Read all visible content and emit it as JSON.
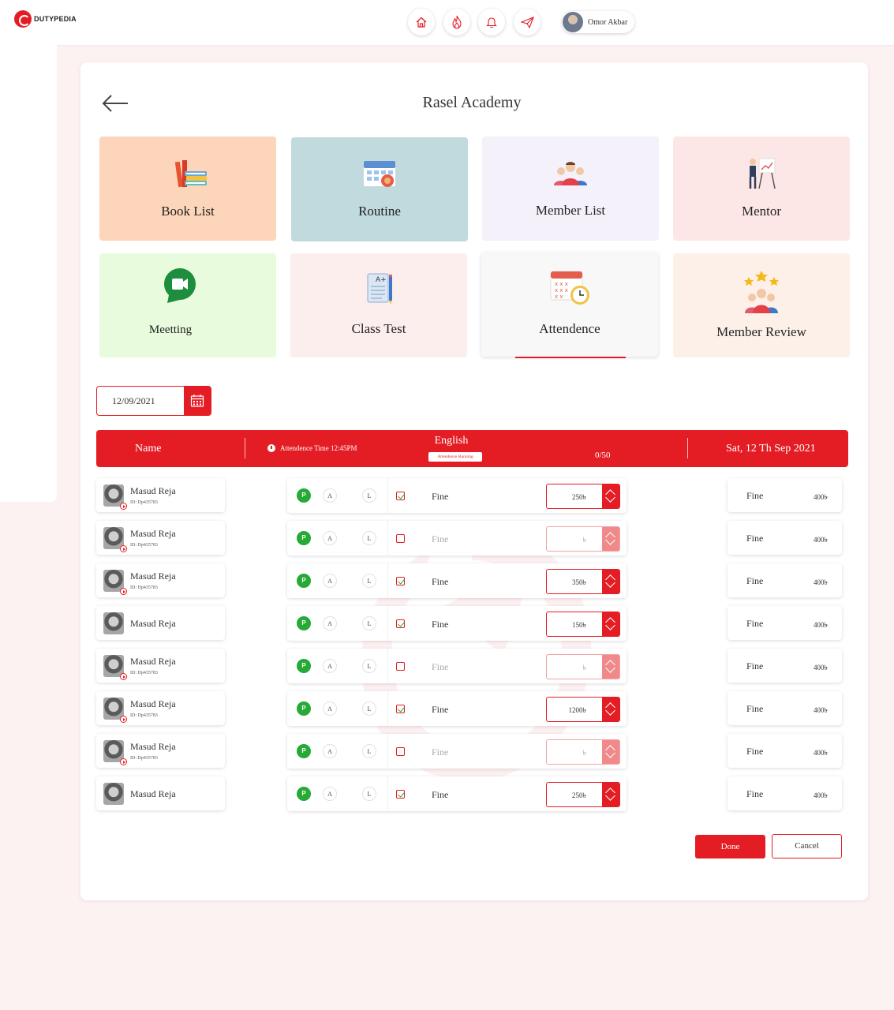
{
  "brand": {
    "name": "DUTYPEDIA",
    "accent": "#e41d25"
  },
  "nav": {
    "icons": [
      "home-icon",
      "fire-icon",
      "bell-icon",
      "send-icon"
    ],
    "user_name": "Omor Akbar"
  },
  "page": {
    "title": "Rasel Academy"
  },
  "tiles": [
    {
      "label": "Book List",
      "bg": "#fcd5ba",
      "icon": "books-icon"
    },
    {
      "label": "Routine",
      "bg": "#c1dade",
      "icon": "calendar-icon"
    },
    {
      "label": "Member List",
      "bg": "#f4f1fb",
      "icon": "members-icon"
    },
    {
      "label": "Mentor",
      "bg": "#fde6e6",
      "icon": "mentor-icon"
    },
    {
      "label": "Meetting",
      "bg": "#e8fbdc",
      "icon": "video-call-icon"
    },
    {
      "label": "Class Test",
      "bg": "#fdeeee",
      "icon": "test-paper-icon"
    },
    {
      "label": "Attendence",
      "bg": "#f8f8f8",
      "icon": "attendance-calendar-icon"
    },
    {
      "label": "Member Review",
      "bg": "#fdf0e9",
      "icon": "review-stars-icon"
    }
  ],
  "date_input": {
    "value": "12/09/2021"
  },
  "table_header": {
    "name": "Name",
    "attendance_time": "Attendence Time 12:45PM",
    "subject": "English",
    "status": "Attendence Running",
    "count": "0/50",
    "date": "Sat, 12 Th Sep 2021"
  },
  "attendance_labels": {
    "present": "P",
    "absent": "A",
    "leave": "L"
  },
  "rows": [
    {
      "name": "Masud Reja",
      "id": "ID: Dp435783",
      "fine_checked": true,
      "fine_label": "Fine",
      "amount": "250৳",
      "right_label": "Fine",
      "right_amount": "400৳"
    },
    {
      "name": "Masud Reja",
      "id": "ID: Dp435783",
      "fine_checked": false,
      "fine_label": "Fine",
      "amount": "৳",
      "right_label": "Fine",
      "right_amount": "400৳"
    },
    {
      "name": "Masud Reja",
      "id": "ID: Dp435783",
      "fine_checked": true,
      "fine_label": "Fine",
      "amount": "350৳",
      "right_label": "Fine",
      "right_amount": "400৳"
    },
    {
      "name": "Masud Reja",
      "id": "",
      "fine_checked": true,
      "fine_label": "Fine",
      "amount": "150৳",
      "right_label": "Fine",
      "right_amount": "400৳"
    },
    {
      "name": "Masud Reja",
      "id": "ID: Dp435783",
      "fine_checked": false,
      "fine_label": "Fine",
      "amount": "৳",
      "right_label": "Fine",
      "right_amount": "400৳"
    },
    {
      "name": "Masud Reja",
      "id": "ID: Dp435783",
      "fine_checked": true,
      "fine_label": "Fine",
      "amount": "1200৳",
      "right_label": "Fine",
      "right_amount": "400৳"
    },
    {
      "name": "Masud Reja",
      "id": "ID: Dp435783",
      "fine_checked": false,
      "fine_label": "Fine",
      "amount": "৳",
      "right_label": "Fine",
      "right_amount": "400৳"
    },
    {
      "name": "Masud Reja",
      "id": "",
      "fine_checked": true,
      "fine_label": "Fine",
      "amount": "250৳",
      "right_label": "Fine",
      "right_amount": "400৳"
    }
  ],
  "actions": {
    "done": "Done",
    "cancel": "Cancel"
  }
}
